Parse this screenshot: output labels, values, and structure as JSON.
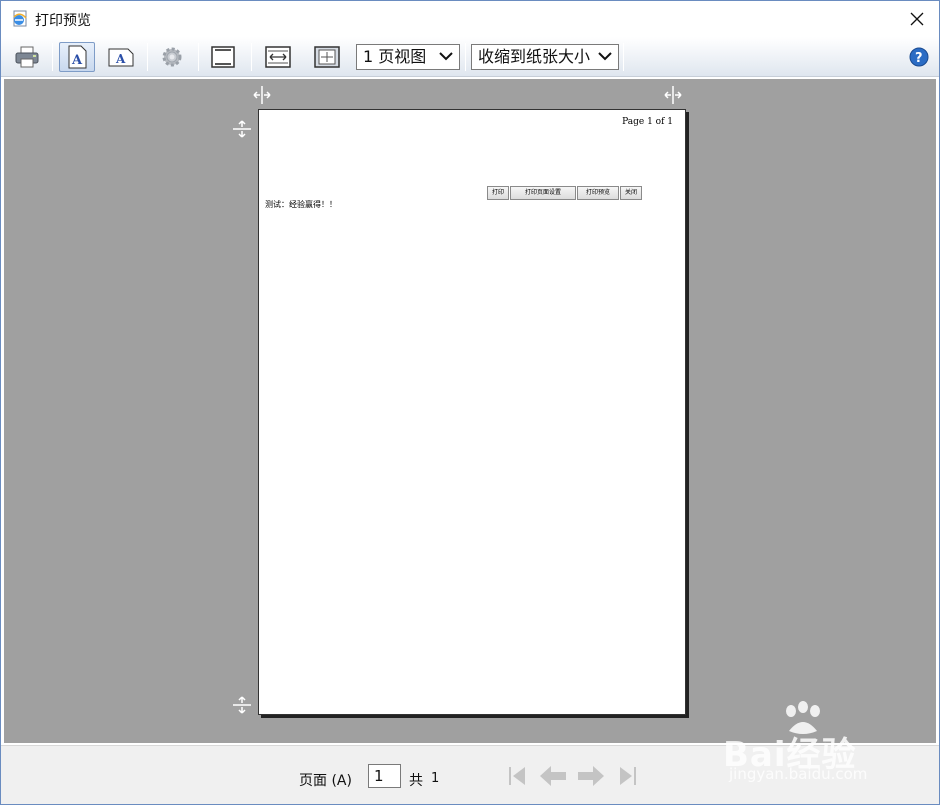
{
  "window": {
    "title": "打印预览"
  },
  "toolbar": {
    "view_select": "1 页视图",
    "scale_select": "收缩到纸张大小"
  },
  "page": {
    "header_page_number": "Page 1 of 1",
    "body_text": "测试：经验赢得！！",
    "mini_buttons": [
      "打印",
      "打印页面设置",
      "打印预览",
      "关闭"
    ]
  },
  "statusbar": {
    "page_label": "页面 (A)",
    "page_value": "1",
    "total_label": "共",
    "total_value": "1"
  },
  "watermark": {
    "brand": "Bai经验",
    "url": "jingyan.baidu.com"
  },
  "colors": {
    "preview_bg": "#a0a0a0",
    "accent": "#2b6cc4"
  }
}
